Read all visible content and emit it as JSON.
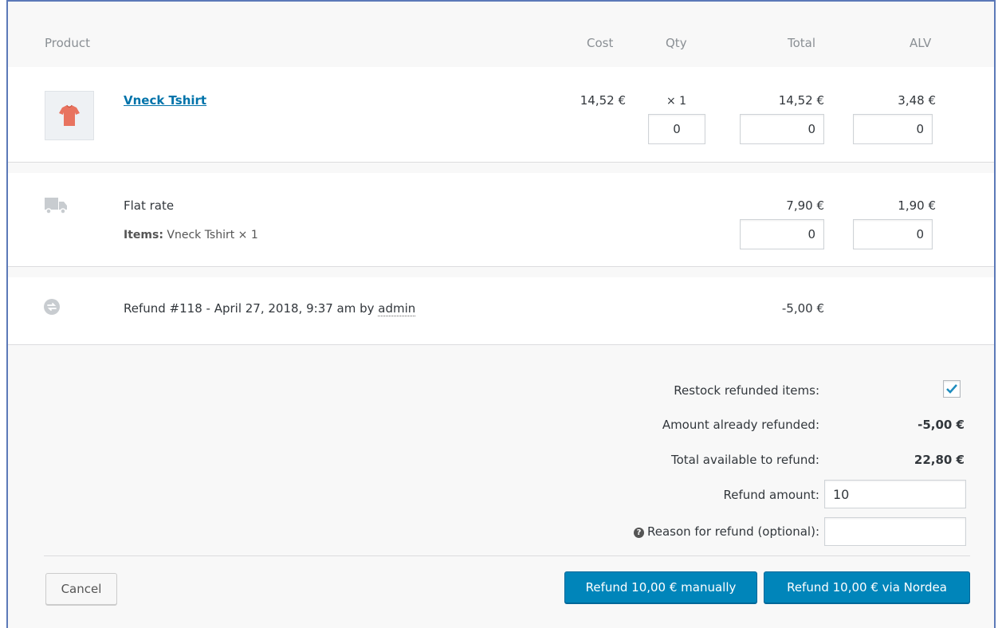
{
  "header": {
    "product": "Product",
    "cost": "Cost",
    "qty": "Qty",
    "total": "Total",
    "tax": "ALV"
  },
  "item": {
    "icon": "tshirt-thumbnail",
    "name": "Vneck Tshirt",
    "cost": "14,52 €",
    "qty": "× 1",
    "total": "14,52 €",
    "tax": "3,48 €",
    "refund_qty_value": "0",
    "refund_total_value": "0",
    "refund_tax_value": "0"
  },
  "shipping": {
    "icon": "truck-icon",
    "name": "Flat rate",
    "items_label": "Items:",
    "items_value": "Vneck Tshirt × 1",
    "total": "7,90 €",
    "tax": "1,90 €",
    "refund_total_value": "0",
    "refund_tax_value": "0"
  },
  "refund_row": {
    "icon": "refund-icon",
    "text": "Refund #118 - April 27, 2018, 9:37 am by ",
    "user": "admin",
    "amount": "-5,00 €"
  },
  "refund_form": {
    "restock_label": "Restock refunded items:",
    "restock_checked": true,
    "already_refunded_label": "Amount already refunded:",
    "already_refunded_value": "-5,00 €",
    "available_label": "Total available to refund:",
    "available_value": "22,80 €",
    "amount_label": "Refund amount:",
    "amount_value": "10",
    "reason_label": "Reason for refund (optional):",
    "reason_value": ""
  },
  "buttons": {
    "cancel": "Cancel",
    "manual": "Refund 10,00 € manually",
    "gateway": "Refund 10,00 € via Nordea"
  },
  "colors": {
    "primary": "#0085ba",
    "link": "#0073aa",
    "frame": "#5b79b8"
  }
}
